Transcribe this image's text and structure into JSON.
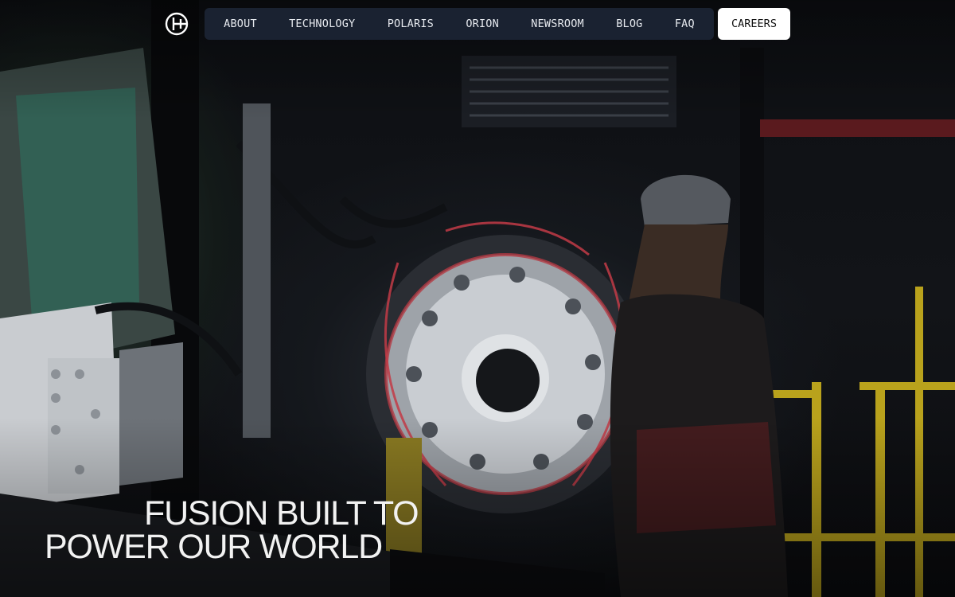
{
  "header": {
    "logo_icon": "fusion-logo-icon",
    "nav": [
      {
        "id": "about",
        "label": "ABOUT"
      },
      {
        "id": "technology",
        "label": "TECHNOLOGY"
      },
      {
        "id": "polaris",
        "label": "POLARIS"
      },
      {
        "id": "orion",
        "label": "ORION"
      },
      {
        "id": "newsroom",
        "label": "NEWSROOM"
      },
      {
        "id": "blog",
        "label": "BLOG"
      },
      {
        "id": "faq",
        "label": "FAQ"
      }
    ],
    "cta_label": "CAREERS"
  },
  "hero": {
    "line1": "FUSION BUILT TO",
    "line2": "POWER OUR WORLD"
  },
  "colors": {
    "nav_bg": "#1c2534",
    "nav_text": "#e6e9ee",
    "cta_bg": "#ffffff",
    "cta_text": "#111111",
    "headline_text": "#f2f2f2"
  }
}
